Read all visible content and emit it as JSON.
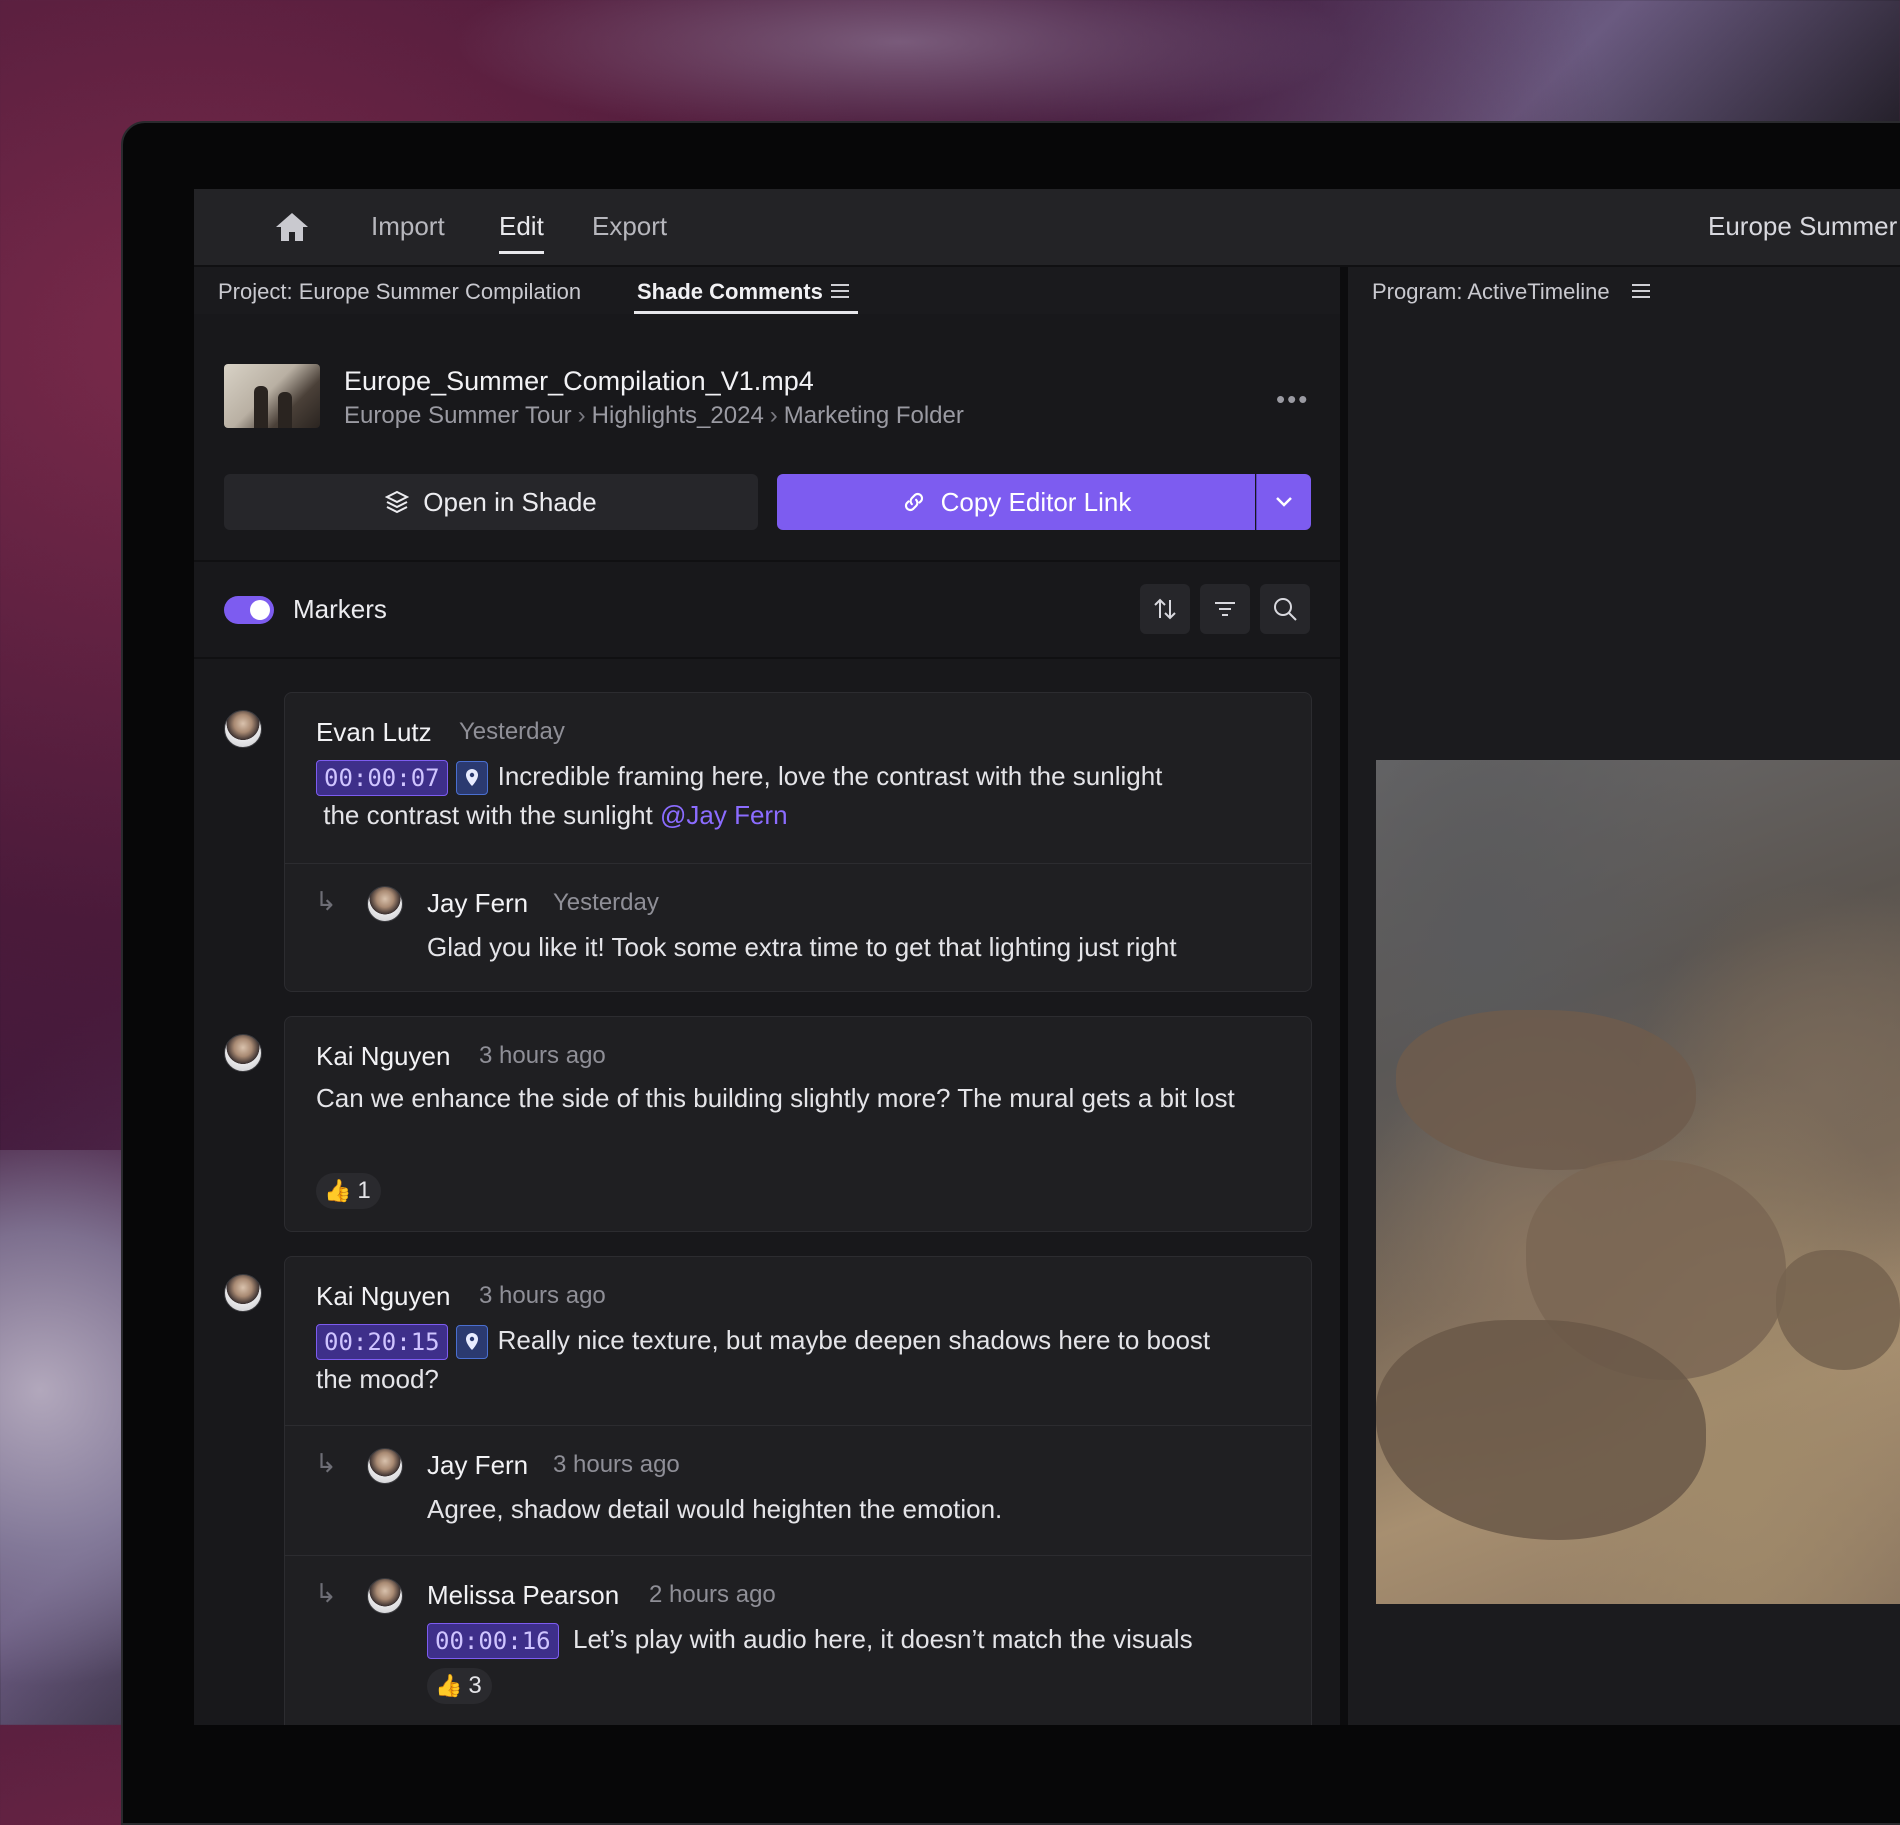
{
  "nav": {
    "items": [
      "Import",
      "Edit",
      "Export"
    ],
    "active": "Edit",
    "doc_title": "Europe Summer"
  },
  "panel": {
    "project_tab": "Project: Europe Summer Compilation",
    "comments_tab": "Shade Comments",
    "program_tab": "Program: ActiveTimeline"
  },
  "file": {
    "name": "Europe_Summer_Compilation_V1.mp4",
    "path": [
      "Europe Summer Tour",
      "Highlights_2024",
      "Marketing Folder"
    ]
  },
  "actions": {
    "open_label": "Open in Shade",
    "copy_label": "Copy Editor Link"
  },
  "markers": {
    "label": "Markers",
    "enabled": true
  },
  "colors": {
    "accent": "#7d5cf0",
    "mention": "#8b6cff"
  },
  "comments": [
    {
      "author": "Evan Lutz",
      "time": "Yesterday",
      "timecode": "00:00:07",
      "text": "Incredible framing here, love the contrast with the sunlight",
      "text2": "the contrast with the sunlight",
      "mention": "@Jay Fern",
      "replies": [
        {
          "author": "Jay Fern",
          "time": "Yesterday",
          "text": "Glad you like it! Took some extra time to get that lighting just right"
        }
      ]
    },
    {
      "author": "Kai Nguyen",
      "time": "3 hours ago",
      "text": "Can we enhance the side of this building slightly more? The mural gets a bit lost",
      "reaction_count": "1"
    },
    {
      "author": "Kai Nguyen",
      "time": "3 hours ago",
      "timecode": "00:20:15",
      "text": "Really nice texture, but maybe deepen shadows here to boost",
      "text2": "the mood?",
      "replies": [
        {
          "author": "Jay Fern",
          "time": "3 hours ago",
          "text": "Agree, shadow detail would heighten the emotion."
        },
        {
          "author": "Melissa Pearson",
          "time": "2 hours ago",
          "timecode": "00:00:16",
          "text": "Let’s play with audio here, it doesn’t match the visuals",
          "reaction_count": "3"
        }
      ]
    }
  ]
}
